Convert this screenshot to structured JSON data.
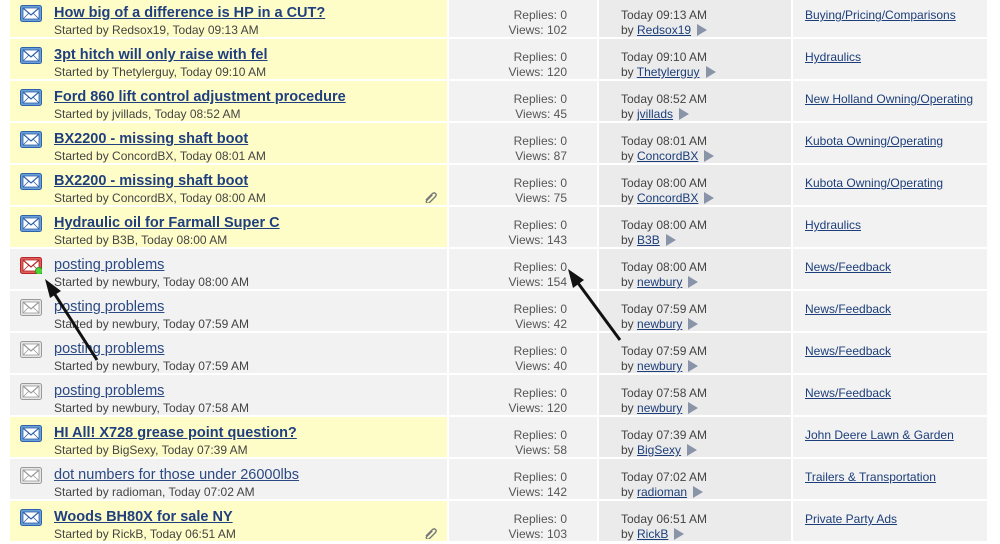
{
  "labels": {
    "replies_prefix": "Replies: ",
    "views_prefix": "Views: ",
    "by_prefix": "by ",
    "started_prefix": "Started by "
  },
  "colors": {
    "unread_bg": "#fefdc8",
    "row_bg": "#f2f2f2",
    "link": "#1c3e7a",
    "new_post_dot": "#4cd137"
  },
  "icons": {
    "unread": "envelope-blue-icon",
    "read": "envelope-gray-icon",
    "new_posts": "envelope-red-new-icon",
    "attachment": "paperclip-icon",
    "goto_last": "arrow-right-icon"
  },
  "threads": [
    {
      "title": "How big of a difference is HP in a CUT?",
      "meta": "Started by Redsox19, Today 09:13 AM",
      "replies": "Replies: 0",
      "views": "Views: 102",
      "last_time": "Today 09:13 AM",
      "last_by": "Redsox19",
      "forum": "Buying/Pricing/Comparisons",
      "state": "unread",
      "attach": false
    },
    {
      "title": "3pt hitch will only raise with fel",
      "meta": "Started by Thetylerguy, Today 09:10 AM",
      "replies": "Replies: 0",
      "views": "Views: 120",
      "last_time": "Today 09:10 AM",
      "last_by": "Thetylerguy",
      "forum": "Hydraulics",
      "state": "unread",
      "attach": false
    },
    {
      "title": "Ford 860 lift control adjustment procedure",
      "meta": "Started by jvillads, Today 08:52 AM",
      "replies": "Replies: 0",
      "views": "Views: 45",
      "last_time": "Today 08:52 AM",
      "last_by": "jvillads",
      "forum": "New Holland Owning/Operating",
      "state": "unread",
      "attach": false
    },
    {
      "title": "BX2200 - missing shaft boot",
      "meta": "Started by ConcordBX, Today 08:01 AM",
      "replies": "Replies: 0",
      "views": "Views: 87",
      "last_time": "Today 08:01 AM",
      "last_by": "ConcordBX",
      "forum": "Kubota Owning/Operating",
      "state": "unread",
      "attach": false
    },
    {
      "title": "BX2200 - missing shaft boot",
      "meta": "Started by ConcordBX, Today 08:00 AM",
      "replies": "Replies: 0",
      "views": "Views: 75",
      "last_time": "Today 08:00 AM",
      "last_by": "ConcordBX",
      "forum": "Kubota Owning/Operating",
      "state": "unread",
      "attach": true
    },
    {
      "title": "Hydraulic oil for Farmall Super C",
      "meta": "Started by B3B, Today 08:00 AM",
      "replies": "Replies: 0",
      "views": "Views: 143",
      "last_time": "Today 08:00 AM",
      "last_by": "B3B",
      "forum": "Hydraulics",
      "state": "unread",
      "attach": false
    },
    {
      "title": "posting problems",
      "meta": "Started by newbury, Today 08:00 AM",
      "replies": "Replies: 0",
      "views": "Views: 154",
      "last_time": "Today 08:00 AM",
      "last_by": "newbury",
      "forum": "News/Feedback",
      "state": "new",
      "attach": false
    },
    {
      "title": "posting problems",
      "meta": "Started by newbury, Today 07:59 AM",
      "replies": "Replies: 0",
      "views": "Views: 42",
      "last_time": "Today 07:59 AM",
      "last_by": "newbury",
      "forum": "News/Feedback",
      "state": "read",
      "attach": false
    },
    {
      "title": "posting problems",
      "meta": "Started by newbury, Today 07:59 AM",
      "replies": "Replies: 0",
      "views": "Views: 40",
      "last_time": "Today 07:59 AM",
      "last_by": "newbury",
      "forum": "News/Feedback",
      "state": "read",
      "attach": false
    },
    {
      "title": "posting problems",
      "meta": "Started by newbury, Today 07:58 AM",
      "replies": "Replies: 0",
      "views": "Views: 120",
      "last_time": "Today 07:58 AM",
      "last_by": "newbury",
      "forum": "News/Feedback",
      "state": "read",
      "attach": false
    },
    {
      "title": "HI All! X728 grease point question?",
      "meta": "Started by BigSexy, Today 07:39 AM",
      "replies": "Replies: 0",
      "views": "Views: 58",
      "last_time": "Today 07:39 AM",
      "last_by": "BigSexy",
      "forum": "John Deere Lawn & Garden",
      "state": "unread",
      "attach": false
    },
    {
      "title": "dot numbers for those under 26000lbs",
      "meta": "Started by radioman, Today 07:02 AM",
      "replies": "Replies: 0",
      "views": "Views: 142",
      "last_time": "Today 07:02 AM",
      "last_by": "radioman",
      "forum": "Trailers & Transportation",
      "state": "read",
      "attach": false
    },
    {
      "title": "Woods BH80X for sale NY",
      "meta": "Started by RickB, Today 06:51 AM",
      "replies": "Replies: 0",
      "views": "Views: 103",
      "last_time": "Today 06:51 AM",
      "last_by": "RickB",
      "forum": "Private Party Ads",
      "state": "unread",
      "attach": true
    }
  ]
}
